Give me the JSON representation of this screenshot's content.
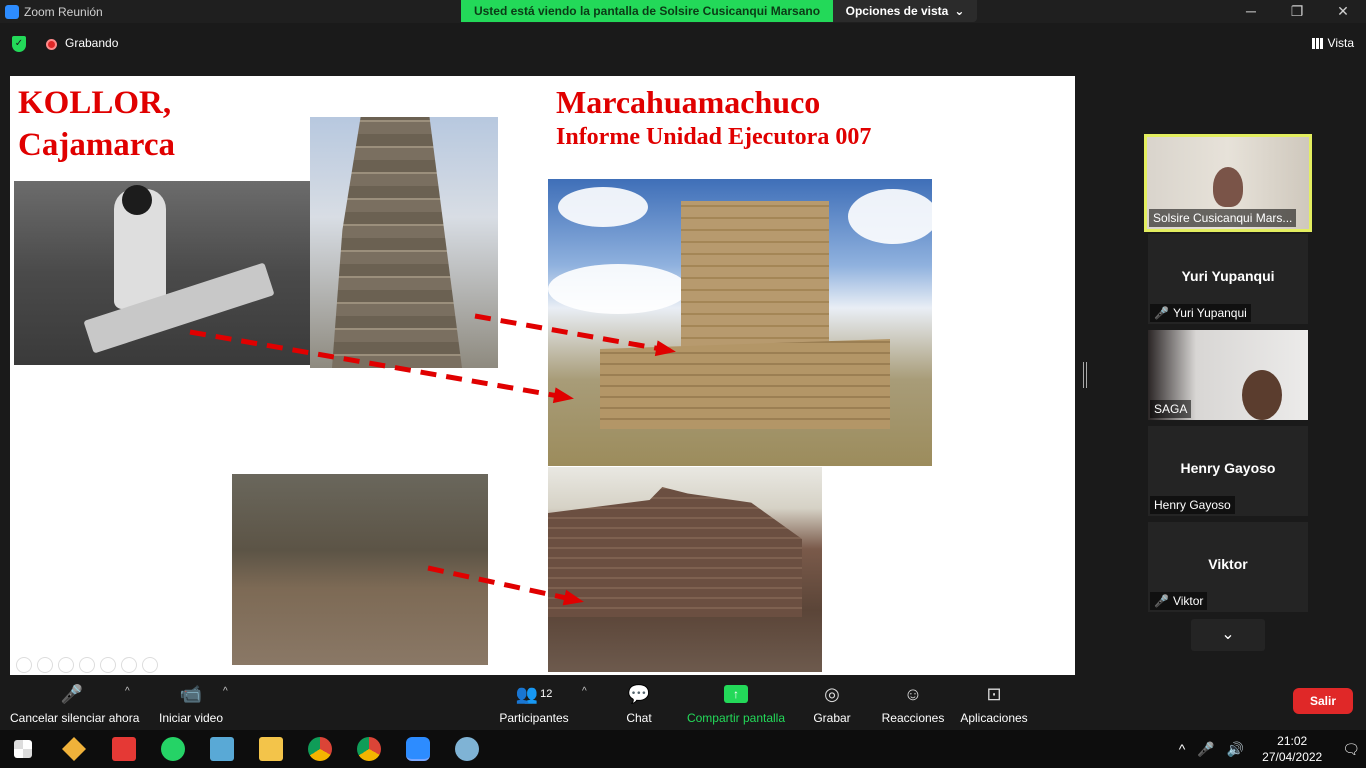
{
  "window": {
    "title": "Zoom Reunión",
    "share_banner": "Usted está viendo la pantalla de Solsire Cusicanqui Marsano",
    "view_options": "Opciones de vista",
    "view_options_caret": "⌄",
    "minimize": "─",
    "restore": "❐",
    "close": "✕"
  },
  "topbar": {
    "security_glyph": "✓",
    "recording_label": "Grabando",
    "vista_label": "Vista"
  },
  "slide": {
    "left_title_line1": "KOLLOR,",
    "left_title_line2": "Cajamarca",
    "right_title": "Marcahuamachuco",
    "right_subtitle": "Informe Unidad Ejecutora 007",
    "arrow_color": "#e00000",
    "title_color": "#e00000"
  },
  "participants_gallery": [
    {
      "name": "Solsire Cusicanqui Mars...",
      "video": true,
      "active": true,
      "muted": false
    },
    {
      "name": "Yuri Yupanqui",
      "label": "Yuri Yupanqui",
      "video": false,
      "muted": true
    },
    {
      "name": "SAGA",
      "video": true,
      "muted": false
    },
    {
      "name": "Henry Gayoso",
      "label": "Henry Gayoso",
      "video": false,
      "muted": false
    },
    {
      "name": "Viktor",
      "label": "Viktor",
      "video": false,
      "muted": true
    }
  ],
  "gallery_icons": {
    "mute_glyph": "🎤",
    "scroll_down": "⌄"
  },
  "toolbar": {
    "unmute_label": "Cancelar silenciar ahora",
    "start_video_label": "Iniciar video",
    "participants_label": "Participantes",
    "participants_count": "12",
    "chat_label": "Chat",
    "share_label": "Compartir pantalla",
    "record_label": "Grabar",
    "reactions_label": "Reacciones",
    "apps_label": "Aplicaciones",
    "leave_label": "Salir",
    "share_glyph": "↑",
    "caret_glyph": "^",
    "mic_glyph": "🎤",
    "video_glyph": "📹",
    "participants_glyph": "👥",
    "chat_glyph": "💬",
    "record_glyph": "◎",
    "reactions_glyph": "☺",
    "apps_glyph": "⊡"
  },
  "taskbar": {
    "time": "21:02",
    "date": "27/04/2022",
    "tray_chevron": "^",
    "tray_mic": "🎤",
    "tray_speaker": "🔊",
    "tray_notifications": "🗨"
  }
}
